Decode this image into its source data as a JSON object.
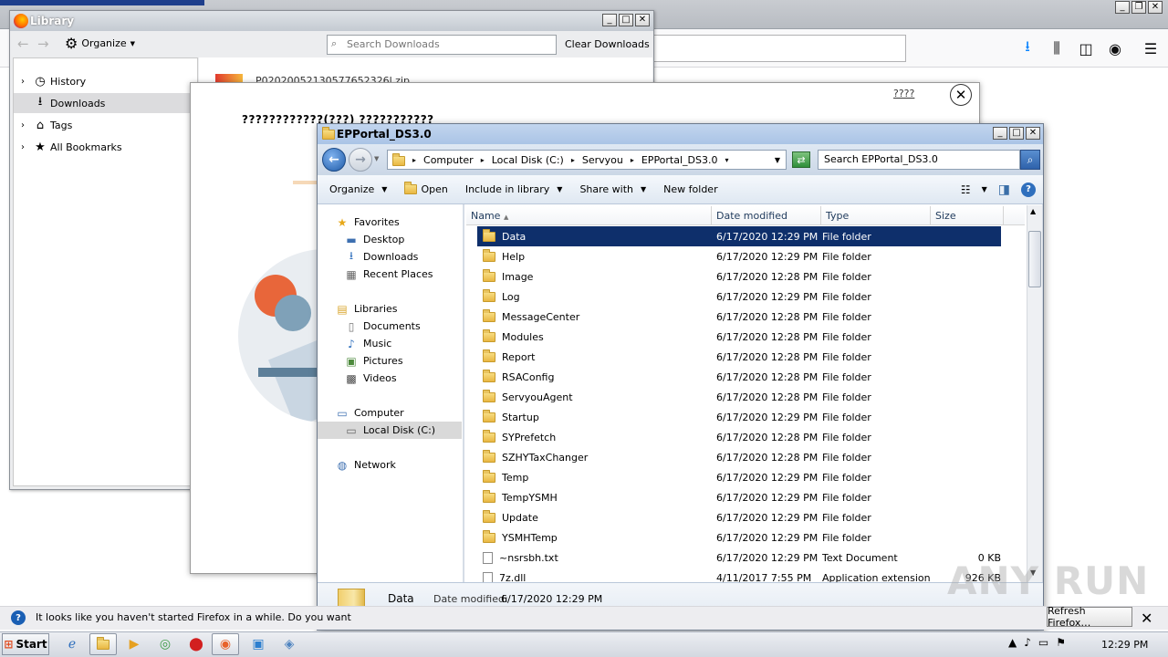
{
  "firefox": {
    "toolbar_icons": [
      "download-icon",
      "library-icon",
      "sidebar-icon",
      "account-icon",
      "menu-icon"
    ]
  },
  "library": {
    "title": "Library",
    "organize_label": "Organize",
    "search_placeholder": "Search Downloads",
    "clear_label": "Clear Downloads",
    "tree": [
      {
        "label": "History",
        "icon": "clock-icon",
        "expandable": true
      },
      {
        "label": "Downloads",
        "icon": "download-icon",
        "expandable": false,
        "selected": true
      },
      {
        "label": "Tags",
        "icon": "tag-icon",
        "expandable": true
      },
      {
        "label": "All Bookmarks",
        "icon": "star-icon",
        "expandable": true
      }
    ],
    "download_file": "P02020052130577652326l.zip"
  },
  "dialog": {
    "link": "????",
    "heading": "????????????(???) ???????????"
  },
  "explorer": {
    "title": "EPPortal_DS3.0",
    "breadcrumb": [
      "Computer",
      "Local Disk (C:)",
      "Servyou",
      "EPPortal_DS3.0"
    ],
    "search_placeholder": "Search EPPortal_DS3.0",
    "commands": [
      "Organize",
      "Open",
      "Include in library",
      "Share with",
      "New folder"
    ],
    "nav": {
      "favorites_label": "Favorites",
      "favorites": [
        "Desktop",
        "Downloads",
        "Recent Places"
      ],
      "libraries_label": "Libraries",
      "libraries": [
        "Documents",
        "Music",
        "Pictures",
        "Videos"
      ],
      "computer_label": "Computer",
      "computer": [
        "Local Disk (C:)"
      ],
      "network_label": "Network"
    },
    "columns": [
      "Name",
      "Date modified",
      "Type",
      "Size"
    ],
    "rows": [
      {
        "name": "Data",
        "date": "6/17/2020 12:29 PM",
        "type": "File folder",
        "size": "",
        "kind": "folder",
        "selected": true
      },
      {
        "name": "Help",
        "date": "6/17/2020 12:29 PM",
        "type": "File folder",
        "size": "",
        "kind": "folder"
      },
      {
        "name": "Image",
        "date": "6/17/2020 12:28 PM",
        "type": "File folder",
        "size": "",
        "kind": "folder"
      },
      {
        "name": "Log",
        "date": "6/17/2020 12:29 PM",
        "type": "File folder",
        "size": "",
        "kind": "folder"
      },
      {
        "name": "MessageCenter",
        "date": "6/17/2020 12:28 PM",
        "type": "File folder",
        "size": "",
        "kind": "folder"
      },
      {
        "name": "Modules",
        "date": "6/17/2020 12:28 PM",
        "type": "File folder",
        "size": "",
        "kind": "folder"
      },
      {
        "name": "Report",
        "date": "6/17/2020 12:28 PM",
        "type": "File folder",
        "size": "",
        "kind": "folder"
      },
      {
        "name": "RSAConfig",
        "date": "6/17/2020 12:28 PM",
        "type": "File folder",
        "size": "",
        "kind": "folder"
      },
      {
        "name": "ServyouAgent",
        "date": "6/17/2020 12:28 PM",
        "type": "File folder",
        "size": "",
        "kind": "folder"
      },
      {
        "name": "Startup",
        "date": "6/17/2020 12:29 PM",
        "type": "File folder",
        "size": "",
        "kind": "folder"
      },
      {
        "name": "SYPrefetch",
        "date": "6/17/2020 12:28 PM",
        "type": "File folder",
        "size": "",
        "kind": "folder"
      },
      {
        "name": "SZHYTaxChanger",
        "date": "6/17/2020 12:28 PM",
        "type": "File folder",
        "size": "",
        "kind": "folder"
      },
      {
        "name": "Temp",
        "date": "6/17/2020 12:29 PM",
        "type": "File folder",
        "size": "",
        "kind": "folder"
      },
      {
        "name": "TempYSMH",
        "date": "6/17/2020 12:29 PM",
        "type": "File folder",
        "size": "",
        "kind": "folder"
      },
      {
        "name": "Update",
        "date": "6/17/2020 12:29 PM",
        "type": "File folder",
        "size": "",
        "kind": "folder"
      },
      {
        "name": "YSMHTemp",
        "date": "6/17/2020 12:29 PM",
        "type": "File folder",
        "size": "",
        "kind": "folder"
      },
      {
        "name": "~nsrsbh.txt",
        "date": "6/17/2020 12:29 PM",
        "type": "Text Document",
        "size": "0 KB",
        "kind": "file"
      },
      {
        "name": "7z.dll",
        "date": "4/11/2017 7:55 PM",
        "type": "Application extension",
        "size": "926 KB",
        "kind": "file"
      }
    ],
    "details": {
      "name": "Data",
      "date_label": "Date modified:",
      "date_value": "6/17/2020 12:29 PM",
      "type": "File folder"
    }
  },
  "notification": {
    "text": "It looks like you haven't started Firefox in a while. Do you want",
    "button": "Refresh Firefox…"
  },
  "taskbar": {
    "start": "Start",
    "clock": "12:29 PM"
  },
  "watermark": "ANY RUN"
}
